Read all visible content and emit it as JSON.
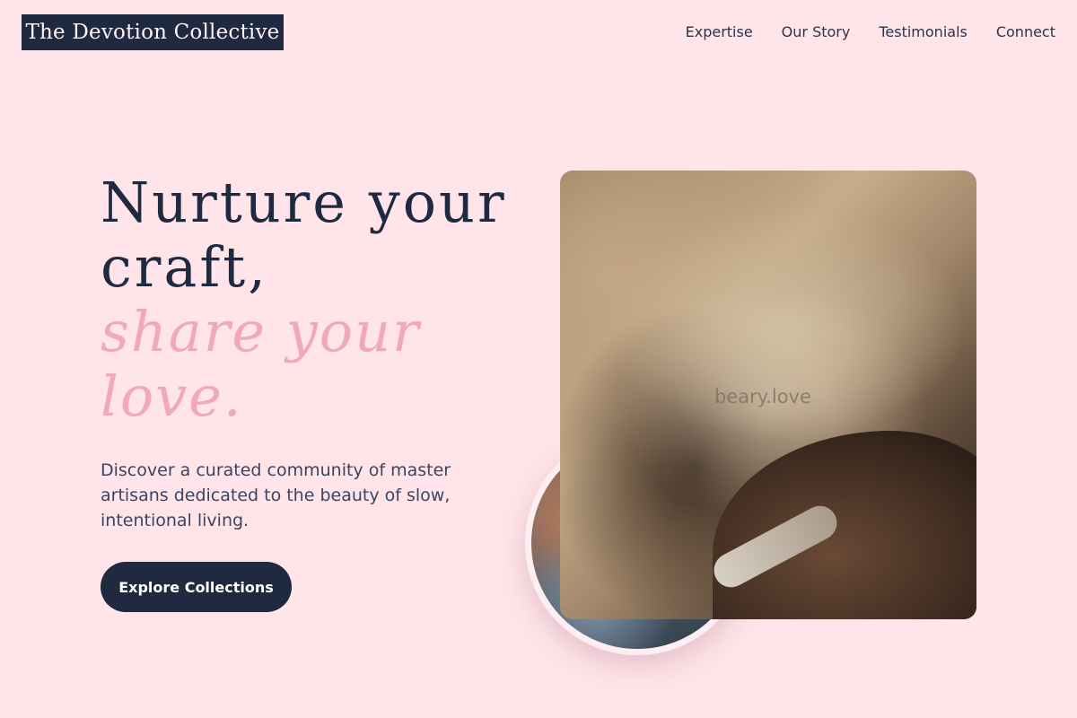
{
  "header": {
    "brand": "The Devotion Collective",
    "nav": [
      {
        "label": "Expertise"
      },
      {
        "label": "Our Story"
      },
      {
        "label": "Testimonials"
      },
      {
        "label": "Connect"
      }
    ]
  },
  "hero": {
    "headline_line1": "Nurture your",
    "headline_line2": "craft,",
    "headline_line3": "share your",
    "headline_line4": "love.",
    "description": "Discover a curated community of master artisans dedicated to the beauty of slow, intentional living.",
    "cta_label": "Explore Collections",
    "image_watermark": "beary.love"
  },
  "colors": {
    "background": "#ffe4ea",
    "navy": "#1f2a40",
    "accent_pink": "#f0a9b9",
    "body_text": "#3c4560"
  }
}
